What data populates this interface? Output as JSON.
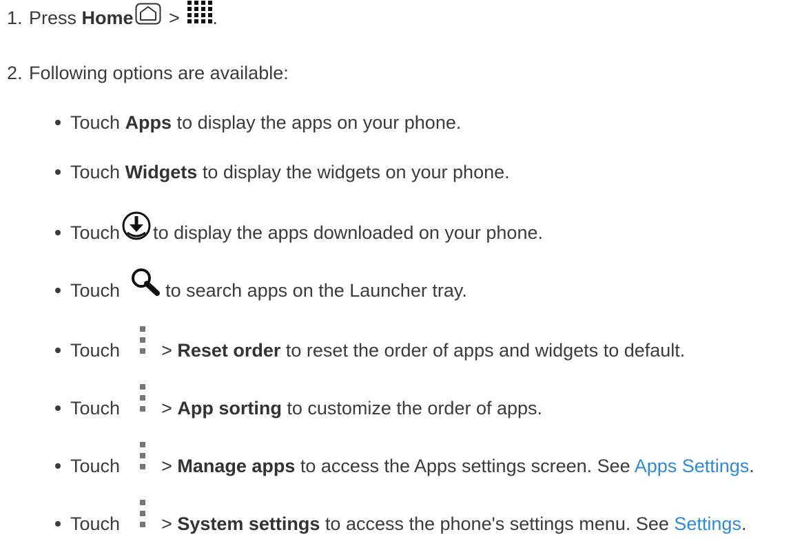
{
  "steps": [
    {
      "num": "1.",
      "text_before": "Press ",
      "bold": "Home",
      "sep": " > ",
      "end": "."
    },
    {
      "num": "2.",
      "text": "Following options are available:"
    }
  ],
  "options": [
    {
      "pre": "Touch ",
      "bold": "Apps",
      "post": " to display the apps on your phone."
    },
    {
      "pre": "Touch ",
      "bold": "Widgets",
      "post": " to display the widgets on your phone."
    },
    {
      "pre": "Touch",
      "post": "to display the apps downloaded on your phone."
    },
    {
      "pre": "Touch",
      "post": "to search apps on the Launcher tray."
    },
    {
      "pre": "Touch",
      "sep": "> ",
      "bold": "Reset order",
      "post": " to reset the order of apps and widgets to default."
    },
    {
      "pre": "Touch",
      "sep": "> ",
      "bold": "App sorting",
      "post": " to customize the order of apps."
    },
    {
      "pre": "Touch",
      "sep": "> ",
      "bold": "Manage apps",
      "post": " to access the Apps settings screen. See ",
      "link": "Apps Settings",
      "end": "."
    },
    {
      "pre": "Touch",
      "sep": "> ",
      "bold": "System settings",
      "post": " to access the phone's settings menu. See ",
      "link": "Settings",
      "end": "."
    }
  ],
  "icons": {
    "home": "home-icon",
    "apps_grid": "apps-grid-icon",
    "download": "download-icon",
    "search": "search-icon",
    "menu": "menu-icon"
  },
  "colors": {
    "text": "#3b3b3b",
    "link": "#2d8ad8"
  }
}
